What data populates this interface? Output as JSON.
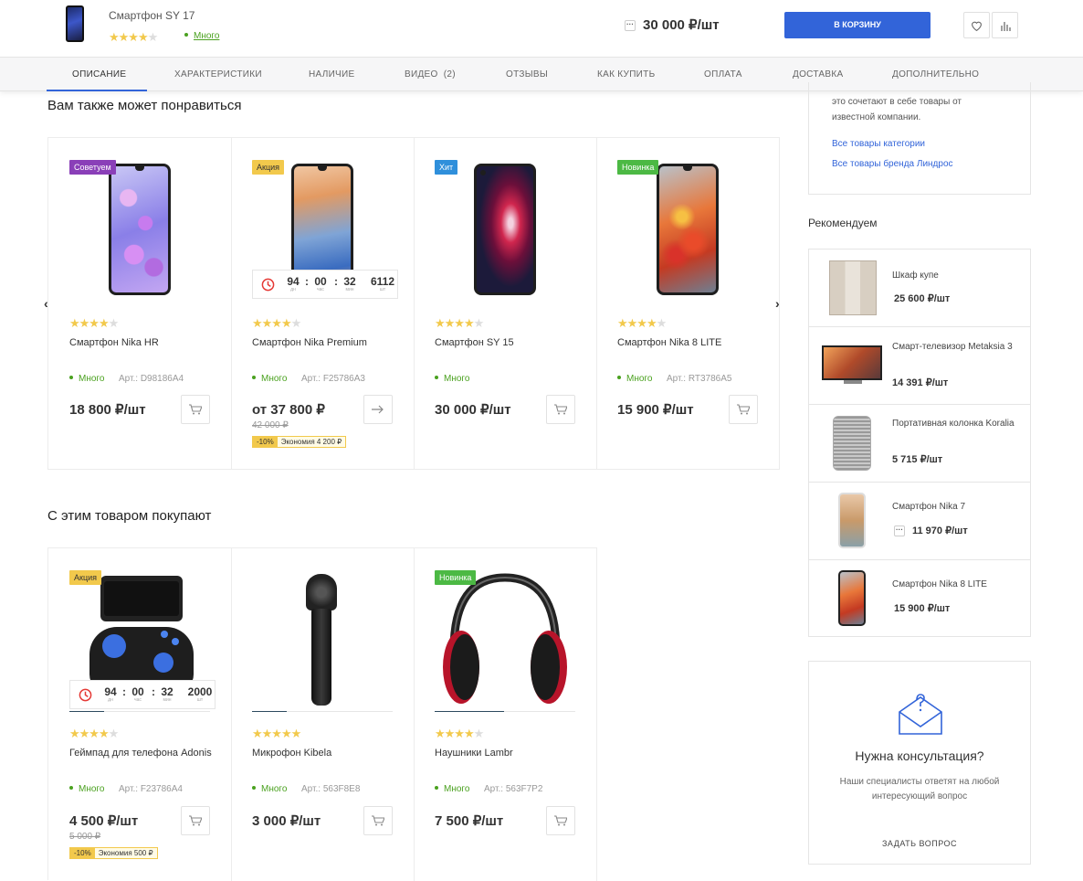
{
  "topbar": {
    "title": "Смартфон SY 17",
    "stars": "★★★★★",
    "stock": "Много",
    "price": "30 000 ₽/шт",
    "cart_button": "В КОРЗИНУ"
  },
  "tabs": [
    "ОПИСАНИЕ",
    "ХАРАКТЕРИСТИКИ",
    "НАЛИЧИЕ",
    "ВИДЕО  (2)",
    "ОТЗЫВЫ",
    "КАК КУПИТЬ",
    "ОПЛАТА",
    "ДОСТАВКА",
    "ДОПОЛНИТЕЛЬНО"
  ],
  "section1": {
    "title": "Вам также может понравиться",
    "cards": [
      {
        "badge": "Советуем",
        "badge_color": "#8a3fb8",
        "name": "Смартфон Nika HR",
        "stock": "Много",
        "art": "Арт.: D98186A4",
        "price": "18 800 ₽/шт"
      },
      {
        "badge": "Акция",
        "badge_color": "#f2c94c",
        "name": "Смартфон Nika Premium",
        "stock": "Много",
        "art": "Арт.: F25786A3",
        "price": "от 37 800 ₽",
        "old_price": "42 000 ₽",
        "discount": "-10%",
        "economy": "Экономия 4 200 ₽",
        "timer": {
          "days": "94",
          "hours": "00",
          "minutes": "32",
          "qty": "6112",
          "l_days": "дн",
          "l_hours": "час",
          "l_minutes": "мин",
          "l_qty": "шт"
        }
      },
      {
        "badge": "Хит",
        "badge_color": "#2f8fdb",
        "name": "Смартфон SY 15",
        "stock": "Много",
        "price": "30 000 ₽/шт"
      },
      {
        "badge": "Новинка",
        "badge_color": "#4cb944",
        "name": "Смартфон Nika 8 LITE",
        "stock": "Много",
        "art": "Арт.: RT3786A5",
        "price": "15 900 ₽/шт"
      }
    ]
  },
  "section2": {
    "title": "С этим товаром покупают",
    "cards": [
      {
        "badge": "Акция",
        "badge_color": "#f2c94c",
        "name": "Геймпад для телефона Adonis",
        "stock": "Много",
        "art": "Арт.: F23786A4",
        "price": "4 500 ₽/шт",
        "old_price": "5 000 ₽",
        "discount": "-10%",
        "economy": "Экономия 500 ₽",
        "timer": {
          "days": "94",
          "hours": "00",
          "minutes": "32",
          "qty": "2000",
          "l_days": "дн",
          "l_hours": "час",
          "l_minutes": "мин",
          "l_qty": "шт"
        }
      },
      {
        "name": "Микрофон Kibela",
        "stock": "Много",
        "art": "Арт.: 563F8E8",
        "price": "3 000 ₽/шт"
      },
      {
        "badge": "Новинка",
        "badge_color": "#4cb944",
        "name": "Наушники Lambr",
        "stock": "Много",
        "art": "Арт.: 563F7P2",
        "price": "7 500 ₽/шт"
      }
    ]
  },
  "sidebar": {
    "brand_text": "это сочетают в себе товары от известной компании.",
    "link_category": "Все товары категории",
    "link_brand": "Все товары бренда Линдрос",
    "recommend_title": "Рекомендуем",
    "recommend": [
      {
        "name": "Шкаф купе",
        "price": "25 600 ₽/шт"
      },
      {
        "name": "Смарт-телевизор Metaksia 3",
        "price": "14 391 ₽/шт"
      },
      {
        "name": "Портативная колонка Koralia",
        "price": "5 715 ₽/шт"
      },
      {
        "name": "Смартфон Nika 7",
        "price": "11 970 ₽/шт"
      },
      {
        "name": "Смартфон Nika 8 LITE",
        "price": "15 900 ₽/шт"
      }
    ],
    "consult_title": "Нужна консультация?",
    "consult_text": "Наши специалисты ответят на любой интересующий вопрос",
    "consult_link": "ЗАДАТЬ ВОПРОС"
  }
}
